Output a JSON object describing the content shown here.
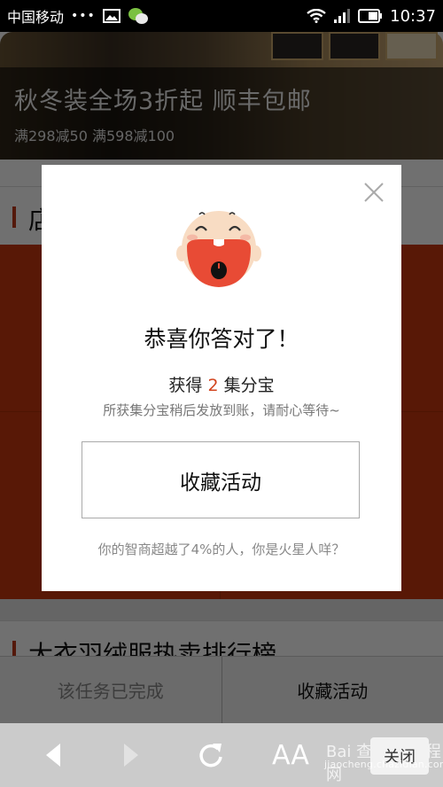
{
  "status_bar": {
    "carrier": "中国移动",
    "dots": "•••",
    "icons": [
      "image-icon",
      "wechat-icon",
      "wifi-icon",
      "signal-icon",
      "battery-icon"
    ],
    "time": "10:37"
  },
  "banner": {
    "title": "秋冬装全场3折起 顺丰包邮",
    "subtitle": "满298减50 满598减100"
  },
  "sections": [
    {
      "label": "店"
    },
    {
      "label": "大衣羽绒服热卖排行榜"
    }
  ],
  "action_bar": {
    "done_label": "该任务已完成",
    "favorite_label": "收藏活动"
  },
  "modal": {
    "title": "恭喜你答对了！",
    "reward_prefix": "获得",
    "reward_amount": "2",
    "reward_suffix": "集分宝",
    "notice": "所获集分宝稍后发放到账，请耐心等待~",
    "button_label": "收藏活动",
    "iq_text": "你的智商超越了4%的人，你是火星人咩？",
    "accent_color": "#d2441e"
  },
  "browser_toolbar": {
    "font_label": "AA",
    "close_label": "关闭",
    "watermark_logo": "Bai 查字典 教程网",
    "watermark_url": "jiaocheng.chazidian.com"
  }
}
